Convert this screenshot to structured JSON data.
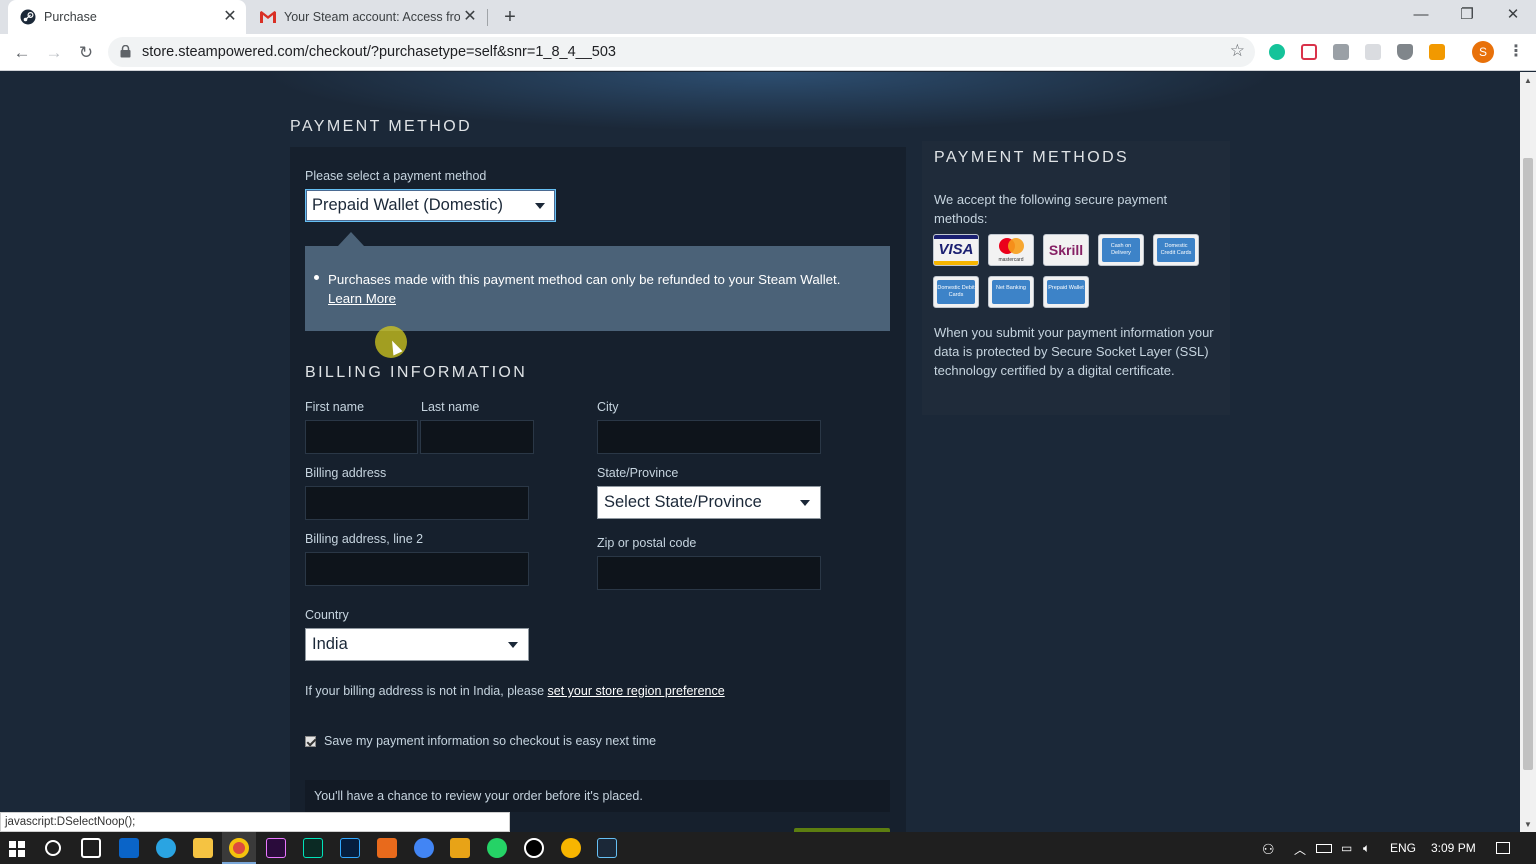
{
  "browser": {
    "tabs": [
      {
        "title": "Purchase",
        "active": true
      },
      {
        "title": "Your Steam account: Access from",
        "active": false
      }
    ],
    "url": "store.steampowered.com/checkout/?purchasetype=self&snr=1_8_4__503",
    "profile_initial": "S",
    "status_url": "javascript:DSelectNoop();"
  },
  "payment": {
    "heading": "PAYMENT METHOD",
    "select_label": "Please select a payment method",
    "selected_method": "Prepaid Wallet (Domestic)",
    "notice_text": "Purchases made with this payment method can only be refunded to your Steam Wallet.",
    "notice_link": "Learn More"
  },
  "billing": {
    "heading": "BILLING INFORMATION",
    "first_name_label": "First name",
    "last_name_label": "Last name",
    "city_label": "City",
    "address_label": "Billing address",
    "state_label": "State/Province",
    "state_value": "Select State/Province",
    "address2_label": "Billing address, line 2",
    "zip_label": "Zip or postal code",
    "country_label": "Country",
    "country_value": "India",
    "region_note_prefix": "If your billing address is not in India, please",
    "region_note_link": "set your store region preference",
    "save_info_label": "Save my payment information so checkout is easy next time",
    "save_info_checked": true,
    "review_note": "You'll have a chance to review your order before it's placed."
  },
  "sidebar": {
    "heading": "PAYMENT METHODS",
    "intro": "We accept the following secure payment methods:",
    "methods": [
      "VISA",
      "mastercard",
      "Skrill",
      "Cash on Delivery",
      "Domestic Credit Cards",
      "Domestic Debit Cards",
      "Net Banking",
      "Prepaid Wallet"
    ],
    "ssl_text": "When you submit your payment information your data is protected by Secure Socket Layer (SSL) technology certified by a digital certificate."
  },
  "taskbar": {
    "language": "ENG",
    "time": "3:09 PM"
  },
  "colors": {
    "page_bg": "#1b2838",
    "panel_bg": "#16202d",
    "notice_bg": "#4b6278",
    "accent": "#66c0f4"
  }
}
